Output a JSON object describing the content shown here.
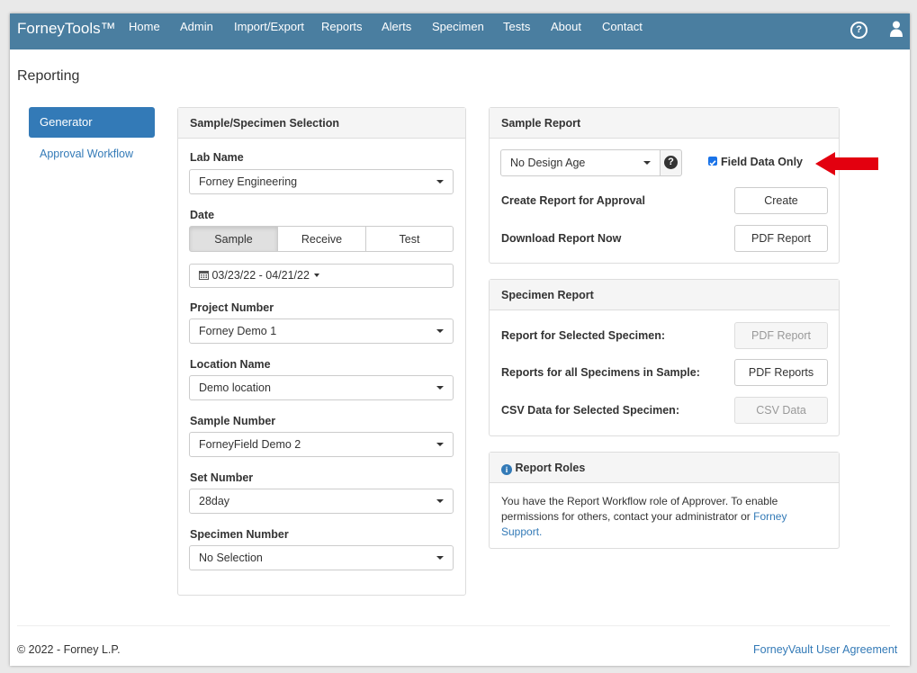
{
  "navbar": {
    "brand": "ForneyTools™",
    "items": [
      "Home",
      "Admin",
      "Import/Export",
      "Reports",
      "Alerts",
      "Specimen",
      "Tests",
      "About",
      "Contact"
    ]
  },
  "page_title": "Reporting",
  "sidebar": {
    "items": [
      {
        "label": "Generator",
        "active": true
      },
      {
        "label": "Approval Workflow",
        "active": false
      }
    ]
  },
  "selection_panel": {
    "title": "Sample/Specimen Selection",
    "lab_name_label": "Lab Name",
    "lab_name_value": "Forney Engineering",
    "date_label": "Date",
    "date_modes": [
      "Sample",
      "Receive",
      "Test"
    ],
    "date_mode_selected": "Sample",
    "date_range": "03/23/22 - 04/21/22",
    "project_label": "Project Number",
    "project_value": "Forney Demo 1",
    "location_label": "Location Name",
    "location_value": "Demo location",
    "sample_label": "Sample Number",
    "sample_value": "ForneyField Demo 2",
    "set_label": "Set Number",
    "set_value": "28day",
    "specimen_label": "Specimen Number",
    "specimen_value": "No Selection"
  },
  "sample_report": {
    "title": "Sample Report",
    "design_age_value": "No Design Age",
    "field_data_only_label": "Field Data Only",
    "field_data_only_checked": true,
    "create_label": "Create Report for Approval",
    "create_button": "Create",
    "download_label": "Download Report Now",
    "pdf_button": "PDF Report"
  },
  "specimen_report": {
    "title": "Specimen Report",
    "selected_label": "Report for Selected Specimen:",
    "selected_button": "PDF Report",
    "all_label": "Reports for all Specimens in Sample:",
    "all_button": "PDF Reports",
    "csv_label": "CSV Data for Selected Specimen:",
    "csv_button": "CSV Data"
  },
  "report_roles": {
    "title": "Report Roles",
    "text": "You have the Report Workflow role of Approver. To enable permissions for others, contact your administrator or ",
    "link": "Forney Support",
    "end": "."
  },
  "footer": {
    "copyright": "© 2022 - Forney L.P.",
    "agreement": "ForneyVault User Agreement"
  },
  "colors": {
    "navbar": "#4a7ea0",
    "primary": "#337ab7",
    "annotation_arrow": "#e3000f"
  }
}
